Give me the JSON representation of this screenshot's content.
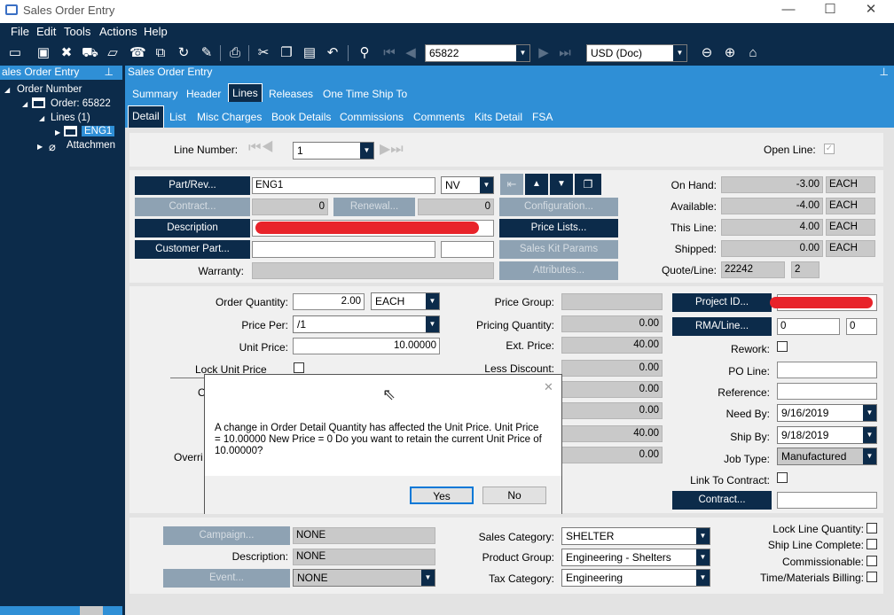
{
  "window": {
    "title": "Sales Order Entry",
    "min": "—",
    "max": "☐",
    "close": "✕"
  },
  "menu": [
    "File",
    "Edit",
    "Tools",
    "Actions",
    "Help"
  ],
  "toolbar": {
    "order_number": "65822",
    "currency": "USD (Doc)"
  },
  "left_panel": {
    "title": "ales Order Entry",
    "tree": {
      "root": "Order Number",
      "order": "Order: 65822",
      "lines": "Lines (1)",
      "line": "ENG1",
      "attach": "Attachmen"
    }
  },
  "right_panel": {
    "title": "Sales Order Entry"
  },
  "tabs_top": [
    "Summary",
    "Header",
    "Lines",
    "Releases",
    "One Time Ship To"
  ],
  "tabs_sub": [
    "Detail",
    "List",
    "Misc Charges",
    "Book Details",
    "Commissions",
    "Comments",
    "Kits Detail",
    "FSA"
  ],
  "line": {
    "label": "Line Number:",
    "value": "1",
    "open_line_label": "Open Line:"
  },
  "part": {
    "part_rev_btn": "Part/Rev...",
    "part_value": "ENG1",
    "rev_value": "NV",
    "contract_btn": "Contract...",
    "contract_value": "0",
    "renewal_btn": "Renewal...",
    "renewal_value": "0",
    "description_btn": "Description",
    "customer_part_btn": "Customer Part...",
    "warranty_label": "Warranty:",
    "configuration_btn": "Configuration...",
    "price_lists_btn": "Price Lists...",
    "sales_kit_btn": "Sales Kit Params",
    "attributes_btn": "Attributes..."
  },
  "stock": {
    "on_hand_label": "On Hand:",
    "on_hand": "-3.00",
    "on_hand_uom": "EACH",
    "available_label": "Available:",
    "available": "-4.00",
    "available_uom": "EACH",
    "this_line_label": "This Line:",
    "this_line": "4.00",
    "this_line_uom": "EACH",
    "shipped_label": "Shipped:",
    "shipped": "0.00",
    "shipped_uom": "EACH",
    "quote_label": "Quote/Line:",
    "quote": "22242",
    "quote_line": "2"
  },
  "pricing": {
    "order_qty_label": "Order Quantity:",
    "order_qty": "2.00",
    "order_uom": "EACH",
    "price_per_label": "Price Per:",
    "price_per": "/1",
    "unit_price_label": "Unit Price:",
    "unit_price": "10.00000",
    "lock_label": "Lock Unit Price",
    "o_label": "O",
    "overri_label": "Overri",
    "price_group_label": "Price Group:",
    "pricing_qty_label": "Pricing Quantity:",
    "pricing_qty": "0.00",
    "ext_price_label": "Ext. Price:",
    "ext_price": "40.00",
    "less_discount_label": "Less Discount:",
    "less_discount": "0.00",
    "r5": "0.00",
    "r6": "0.00",
    "r7": "40.00",
    "r8": "0.00"
  },
  "right_fields": {
    "project_btn": "Project ID...",
    "rma_btn": "RMA/Line...",
    "rma1": "0",
    "rma2": "0",
    "rework_label": "Rework:",
    "po_line_label": "PO Line:",
    "reference_label": "Reference:",
    "need_by_label": "Need By:",
    "need_by": "9/16/2019",
    "ship_by_label": "Ship By:",
    "ship_by": "9/18/2019",
    "job_type_label": "Job Type:",
    "job_type": "Manufactured",
    "link_contract_label": "Link To Contract:",
    "contract_btn": "Contract..."
  },
  "bottom": {
    "campaign_btn": "Campaign...",
    "campaign": "NONE",
    "description_label": "Description:",
    "description": "NONE",
    "event_btn": "Event...",
    "event": "NONE",
    "sales_cat_label": "Sales Category:",
    "sales_cat": "SHELTER",
    "product_group_label": "Product Group:",
    "product_group": "Engineering - Shelters",
    "tax_cat_label": "Tax Category:",
    "tax_cat": "Engineering",
    "lock_line_qty": "Lock Line Quantity:",
    "ship_line_complete": "Ship Line Complete:",
    "commissionable": "Commissionable:",
    "tm_billing": "Time/Materials Billing:"
  },
  "dialog": {
    "message": "A change in Order Detail Quantity has affected the Unit Price.  Unit Price = 10.00000 New Price = 0 Do you want to retain the current Unit Price of 10.00000?",
    "yes": "Yes",
    "no": "No",
    "close": "✕"
  }
}
